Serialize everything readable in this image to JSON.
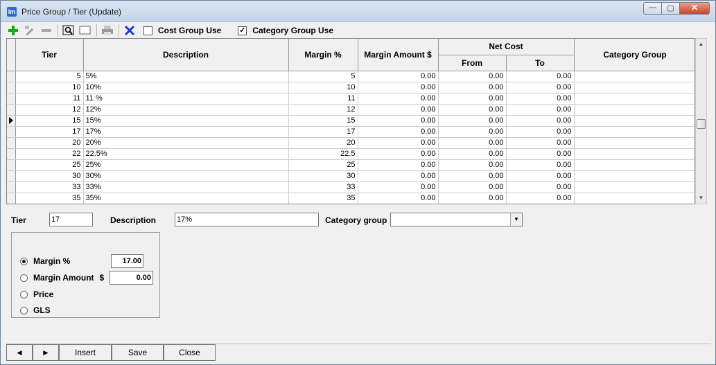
{
  "window": {
    "title": "Price Group / Tier (Update)",
    "app_icon_text": "lm",
    "min_glyph": "—",
    "max_glyph": "▢",
    "close_glyph": "✕"
  },
  "toolbar": {
    "cost_group_label": "Cost Group Use",
    "cost_group_checked": false,
    "category_group_label": "Category Group Use",
    "category_group_checked": true,
    "check_glyph": "✓",
    "colors": {
      "add": "#18a818",
      "delete": "#1c3fcf"
    }
  },
  "grid": {
    "headers": {
      "tier": "Tier",
      "description": "Description",
      "margin_pct": "Margin %",
      "margin_amount": "Margin Amount $",
      "net_cost": "Net Cost",
      "from": "From",
      "to": "To",
      "category_group": "Category Group"
    },
    "selected_row_index": 4,
    "rows": [
      {
        "tier": "5",
        "description": "5%",
        "margin": "5",
        "amount": "0.00",
        "from": "0.00",
        "to": "0.00",
        "category": ""
      },
      {
        "tier": "10",
        "description": "10%",
        "margin": "10",
        "amount": "0.00",
        "from": "0.00",
        "to": "0.00",
        "category": ""
      },
      {
        "tier": "11",
        "description": "11 %",
        "margin": "11",
        "amount": "0.00",
        "from": "0.00",
        "to": "0.00",
        "category": ""
      },
      {
        "tier": "12",
        "description": "12%",
        "margin": "12",
        "amount": "0.00",
        "from": "0.00",
        "to": "0.00",
        "category": ""
      },
      {
        "tier": "15",
        "description": "15%",
        "margin": "15",
        "amount": "0.00",
        "from": "0.00",
        "to": "0.00",
        "category": ""
      },
      {
        "tier": "17",
        "description": "17%",
        "margin": "17",
        "amount": "0.00",
        "from": "0.00",
        "to": "0.00",
        "category": ""
      },
      {
        "tier": "20",
        "description": "20%",
        "margin": "20",
        "amount": "0.00",
        "from": "0.00",
        "to": "0.00",
        "category": ""
      },
      {
        "tier": "22",
        "description": "22.5%",
        "margin": "22.5",
        "amount": "0.00",
        "from": "0.00",
        "to": "0.00",
        "category": ""
      },
      {
        "tier": "25",
        "description": "25%",
        "margin": "25",
        "amount": "0.00",
        "from": "0.00",
        "to": "0.00",
        "category": ""
      },
      {
        "tier": "30",
        "description": "30%",
        "margin": "30",
        "amount": "0.00",
        "from": "0.00",
        "to": "0.00",
        "category": ""
      },
      {
        "tier": "33",
        "description": "33%",
        "margin": "33",
        "amount": "0.00",
        "from": "0.00",
        "to": "0.00",
        "category": ""
      },
      {
        "tier": "35",
        "description": "35%",
        "margin": "35",
        "amount": "0.00",
        "from": "0.00",
        "to": "0.00",
        "category": ""
      }
    ]
  },
  "form": {
    "tier_label": "Tier",
    "tier_value": "17",
    "description_label": "Description",
    "description_value": "17%",
    "category_group_label": "Category group",
    "category_group_value": ""
  },
  "mode": {
    "margin_pct_label": "Margin %",
    "margin_pct_value": "17.00",
    "margin_amount_label": "Margin Amount",
    "margin_amount_unit": "$",
    "margin_amount_value": "0.00",
    "price_label": "Price",
    "gls_label": "GLS",
    "selected": "margin_pct"
  },
  "bottom": {
    "prev_glyph": "◄",
    "next_glyph": "►",
    "insert_label": "Insert",
    "save_label": "Save",
    "close_label": "Close"
  }
}
